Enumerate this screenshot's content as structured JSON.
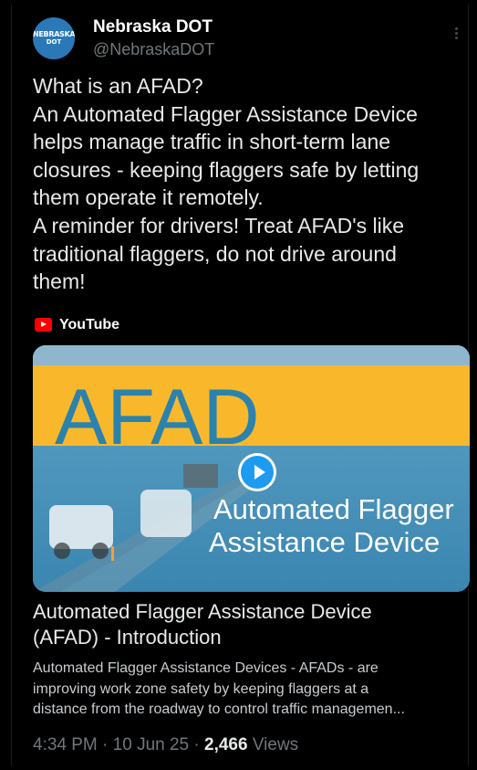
{
  "account": {
    "display_name": "Nebraska DOT",
    "handle": "@NebraskaDOT",
    "avatar_line1": "NEBRASKA",
    "avatar_line2": "DOT"
  },
  "tweet": {
    "lines": [
      "What is an AFAD?",
      "An Automated Flagger Assistance Device",
      "helps manage traffic in short-term lane",
      "closures - keeping flaggers safe by letting",
      "them operate it remotely.",
      "A reminder for drivers! Treat AFAD's like",
      "traditional flaggers, do not drive around",
      "them!"
    ]
  },
  "card": {
    "source": "YouTube",
    "source_icon": "youtube-icon",
    "thumbnail_headline": "AFAD",
    "thumbnail_subtitle_line1": "Automated Flagger",
    "thumbnail_subtitle_line2": "Assistance Device",
    "play_icon": "play-icon",
    "title_line1": "Automated Flagger Assistance Device",
    "title_line2": "(AFAD) - Introduction",
    "description_lines": [
      "Automated Flagger Assistance Devices - AFADs - are",
      "improving work zone safety by keeping flaggers at a",
      "distance from the roadway to control traffic managemen..."
    ]
  },
  "meta": {
    "time": "4:34 PM",
    "separator": " · ",
    "date": "10 Jun 25",
    "views_count": "2,466",
    "views_label": "Views"
  },
  "colors": {
    "background": "#000000",
    "text": "#e7e9ea",
    "muted": "#71767b",
    "thumbnail_yellow": "#f9b82c",
    "thumbnail_blue": "#2a82ad",
    "play_blue": "#1d9bf0",
    "youtube_red": "#ff0000"
  }
}
